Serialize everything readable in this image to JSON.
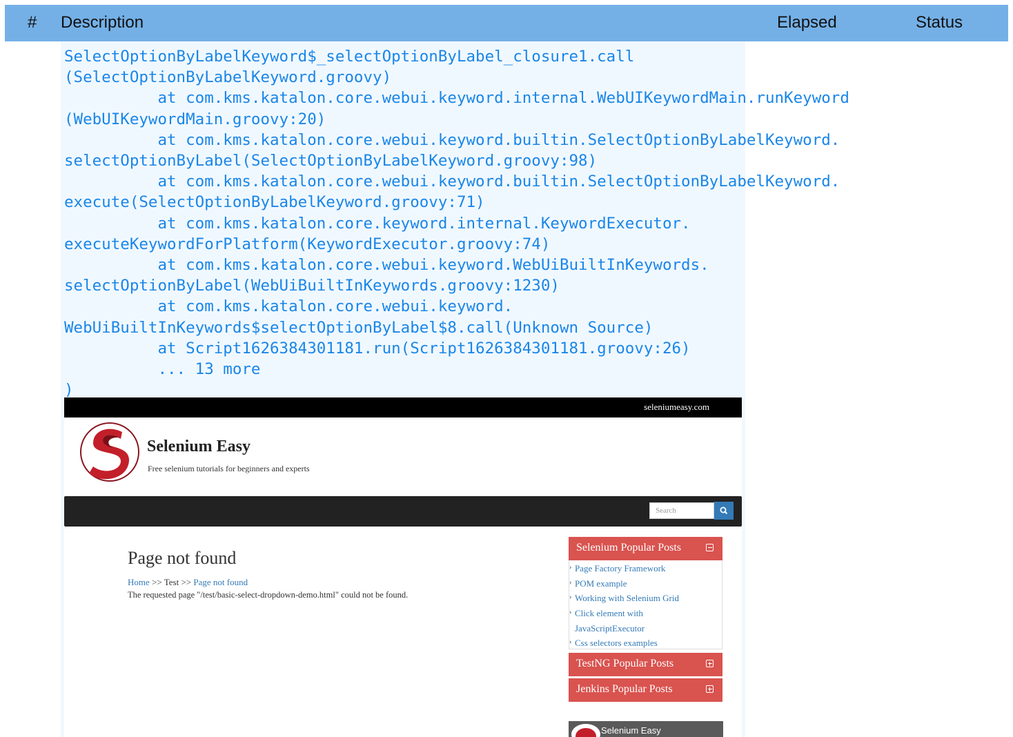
{
  "header": {
    "col_number": "#",
    "col_description": "Description",
    "col_elapsed": "Elapsed",
    "col_status": "Status"
  },
  "log": {
    "lines": [
      "SelectOptionByLabelKeyword$_selectOptionByLabel_closure1.call",
      "(SelectOptionByLabelKeyword.groovy)",
      "          at com.kms.katalon.core.webui.keyword.internal.WebUIKeywordMain.runKeyword",
      "(WebUIKeywordMain.groovy:20)",
      "          at com.kms.katalon.core.webui.keyword.builtin.SelectOptionByLabelKeyword.",
      "selectOptionByLabel(SelectOptionByLabelKeyword.groovy:98)",
      "          at com.kms.katalon.core.webui.keyword.builtin.SelectOptionByLabelKeyword.",
      "execute(SelectOptionByLabelKeyword.groovy:71)",
      "          at com.kms.katalon.core.keyword.internal.KeywordExecutor.",
      "executeKeywordForPlatform(KeywordExecutor.groovy:74)",
      "          at com.kms.katalon.core.webui.keyword.WebUiBuiltInKeywords.",
      "selectOptionByLabel(WebUiBuiltInKeywords.groovy:1230)",
      "          at com.kms.katalon.core.webui.keyword.",
      "WebUiBuiltInKeywords$selectOptionByLabel$8.call(Unknown Source)",
      "          at Script1626384301181.run(Script1626384301181.groovy:26)",
      "          ... 13 more",
      ")"
    ]
  },
  "screenshot": {
    "topbar_link": "seleniumeasy.com",
    "brand": "Selenium Easy",
    "tagline": "Free selenium tutorials for beginners and experts",
    "search_placeholder": "Search",
    "page_title": "Page not found",
    "breadcrumb": {
      "home": "Home",
      "sep1": ">>",
      "test": "Test",
      "sep2": ">>",
      "current": "Page not found"
    },
    "message": "The requested page \"/test/basic-select-dropdown-demo.html\" could not be found.",
    "panels": {
      "selenium": {
        "title": "Selenium Popular Posts",
        "items": [
          "Page Factory Framework",
          "POM example",
          "Working with Selenium Grid",
          "Click element with",
          "JavaScriptExecutor",
          "Css selectors examples"
        ]
      },
      "testng": {
        "title": "TestNG Popular Posts"
      },
      "jenkins": {
        "title": "Jenkins Popular Posts"
      }
    },
    "video_title": "Selenium Easy",
    "colors": {
      "header_bg": "#74b0e6",
      "log_bg": "#f0f8ff",
      "log_text": "#1a86e8",
      "panel_red": "#d9534f",
      "link_blue": "#337ab7",
      "navbar": "#222222"
    }
  }
}
